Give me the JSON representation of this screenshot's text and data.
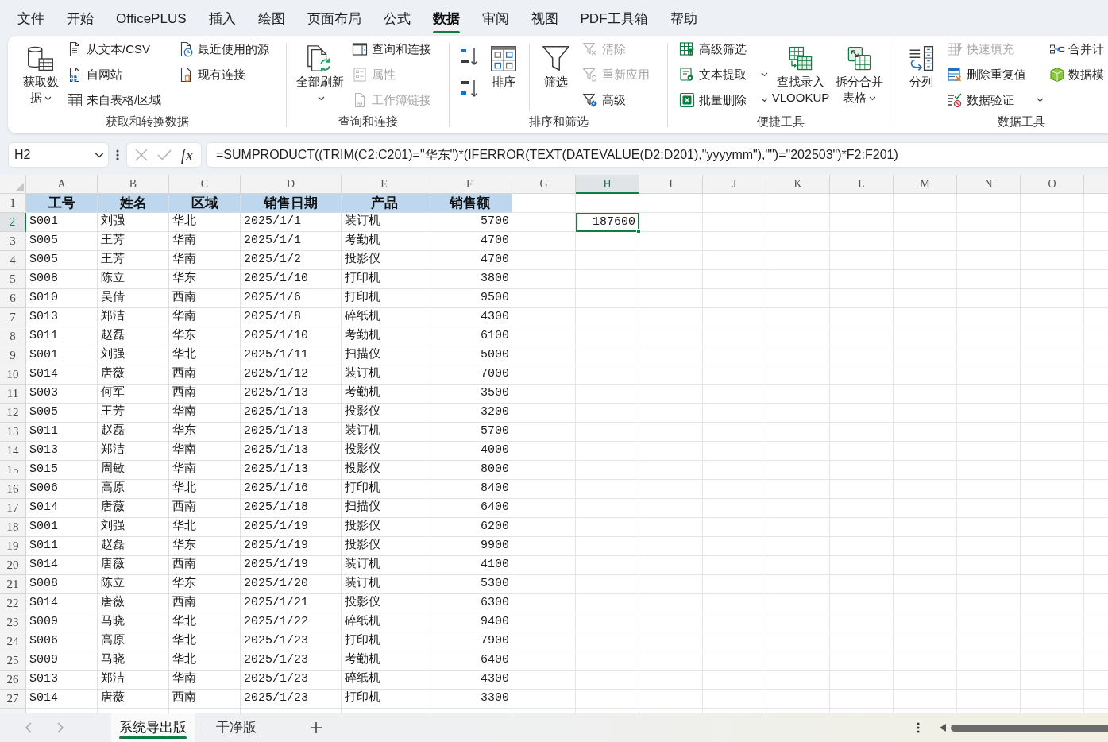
{
  "menu_tabs": [
    {
      "label": "文件",
      "selected": false
    },
    {
      "label": "开始",
      "selected": false
    },
    {
      "label": "OfficePLUS",
      "selected": false
    },
    {
      "label": "插入",
      "selected": false
    },
    {
      "label": "绘图",
      "selected": false
    },
    {
      "label": "页面布局",
      "selected": false
    },
    {
      "label": "公式",
      "selected": false
    },
    {
      "label": "数据",
      "selected": true
    },
    {
      "label": "审阅",
      "selected": false
    },
    {
      "label": "视图",
      "selected": false
    },
    {
      "label": "PDF工具箱",
      "selected": false
    },
    {
      "label": "帮助",
      "selected": false
    }
  ],
  "ribbon": {
    "groups": [
      {
        "label": "获取和转换数据",
        "columns": [
          {
            "kind": "large",
            "label": "获取数据",
            "disabled": false,
            "dropdown": true
          },
          {
            "kind": "stack",
            "items": [
              {
                "label": "从文本/CSV",
                "disabled": false,
                "dropdown": false
              },
              {
                "label": "自网站",
                "disabled": false,
                "dropdown": false
              },
              {
                "label": "来自表格/区域",
                "disabled": false,
                "dropdown": false
              }
            ]
          },
          {
            "kind": "stack",
            "items": [
              {
                "label": "最近使用的源",
                "disabled": false,
                "dropdown": false
              },
              {
                "label": "现有连接",
                "disabled": false,
                "dropdown": false
              }
            ]
          }
        ]
      },
      {
        "label": "查询和连接",
        "columns": [
          {
            "kind": "large",
            "label": "全部刷新",
            "disabled": false,
            "dropdown": true
          },
          {
            "kind": "stack",
            "items": [
              {
                "label": "查询和连接",
                "disabled": false,
                "dropdown": false
              },
              {
                "label": "属性",
                "disabled": true,
                "dropdown": false
              },
              {
                "label": "工作簿链接",
                "disabled": true,
                "dropdown": false
              }
            ]
          }
        ]
      },
      {
        "label": "排序和筛选",
        "columns": [
          {
            "kind": "sort_buttons"
          },
          {
            "kind": "large",
            "label": "排序",
            "disabled": false,
            "dropdown": false
          },
          {
            "kind": "divider"
          },
          {
            "kind": "large",
            "label": "筛选",
            "disabled": false,
            "dropdown": false
          },
          {
            "kind": "stack",
            "items": [
              {
                "label": "清除",
                "disabled": true,
                "dropdown": false
              },
              {
                "label": "重新应用",
                "disabled": true,
                "dropdown": false
              },
              {
                "label": "高级",
                "disabled": false,
                "dropdown": false
              }
            ]
          }
        ]
      },
      {
        "label": "便捷工具",
        "columns": [
          {
            "kind": "stack",
            "items": [
              {
                "label": "高级筛选",
                "disabled": false,
                "dropdown": false
              },
              {
                "label": "文本提取",
                "disabled": false,
                "dropdown": true
              },
              {
                "label": "批量删除",
                "disabled": false,
                "dropdown": true
              }
            ]
          },
          {
            "kind": "large",
            "label": "查找录入 VLOOKUP",
            "disabled": false,
            "dropdown": false
          },
          {
            "kind": "large",
            "label": "拆分合并表格",
            "disabled": false,
            "dropdown": true
          }
        ]
      },
      {
        "label": "数据工具",
        "columns": [
          {
            "kind": "large",
            "label": "分列",
            "disabled": false,
            "dropdown": false
          },
          {
            "kind": "stack",
            "items": [
              {
                "label": "快速填充",
                "disabled": true,
                "dropdown": false
              },
              {
                "label": "删除重复值",
                "disabled": false,
                "dropdown": false
              },
              {
                "label": "数据验证",
                "disabled": false,
                "dropdown": true
              }
            ]
          },
          {
            "kind": "stack",
            "items": [
              {
                "label": "合并计",
                "disabled": false
              },
              {
                "label": "数据模",
                "disabled": false
              }
            ]
          }
        ]
      }
    ]
  },
  "formula_bar": {
    "name_box": "H2",
    "function_button": "fx",
    "formula": "=SUMPRODUCT((TRIM(C2:C201)=\"华东\")*(IFERROR(TEXT(DATEVALUE(D2:D201),\"yyyymm\"),\"\")=\"202503\")*F2:F201)"
  },
  "sheet": {
    "columns": [
      {
        "label": "A",
        "selected": false
      },
      {
        "label": "B",
        "selected": false
      },
      {
        "label": "C",
        "selected": false
      },
      {
        "label": "D",
        "selected": false
      },
      {
        "label": "E",
        "selected": false
      },
      {
        "label": "F",
        "selected": false
      },
      {
        "label": "G",
        "selected": false
      },
      {
        "label": "H",
        "selected": true
      },
      {
        "label": "I",
        "selected": false
      },
      {
        "label": "J",
        "selected": false
      },
      {
        "label": "K",
        "selected": false
      },
      {
        "label": "L",
        "selected": false
      },
      {
        "label": "M",
        "selected": false
      },
      {
        "label": "N",
        "selected": false
      },
      {
        "label": "O",
        "selected": false
      }
    ],
    "rows": [
      {
        "number": "1",
        "selected": false,
        "kind": "header",
        "cells": [
          "工号",
          "姓名",
          "区域",
          "销售日期",
          "产品",
          "销售额"
        ]
      },
      {
        "number": "2",
        "selected": true,
        "kind": "data",
        "cells": [
          "S001",
          "刘强",
          "华北",
          "2025/1/1",
          "装订机",
          "5700"
        ]
      },
      {
        "number": "3",
        "selected": false,
        "kind": "data",
        "cells": [
          "S005",
          "王芳",
          "华南",
          "2025/1/1",
          "考勤机",
          "4700"
        ]
      },
      {
        "number": "4",
        "selected": false,
        "kind": "data",
        "cells": [
          "S005",
          "王芳",
          "华南",
          "2025/1/2",
          "投影仪",
          "4700"
        ]
      },
      {
        "number": "5",
        "selected": false,
        "kind": "data",
        "cells": [
          "S008",
          "陈立",
          "华东",
          "2025/1/10",
          "打印机",
          "3800"
        ]
      },
      {
        "number": "6",
        "selected": false,
        "kind": "data",
        "cells": [
          "S010",
          "吴倩",
          "西南",
          "2025/1/6",
          "打印机",
          "9500"
        ]
      },
      {
        "number": "7",
        "selected": false,
        "kind": "data",
        "cells": [
          "S013",
          "郑洁",
          "华南",
          "2025/1/8",
          "碎纸机",
          "4300"
        ]
      },
      {
        "number": "8",
        "selected": false,
        "kind": "data",
        "cells": [
          "S011",
          "赵磊",
          "华东",
          "2025/1/10",
          "考勤机",
          "6100"
        ]
      },
      {
        "number": "9",
        "selected": false,
        "kind": "data",
        "cells": [
          "S001",
          "刘强",
          "华北",
          "2025/1/11",
          "扫描仪",
          "5000"
        ]
      },
      {
        "number": "10",
        "selected": false,
        "kind": "data",
        "cells": [
          "S014",
          "唐薇",
          "西南",
          "2025/1/12",
          "装订机",
          "7000"
        ]
      },
      {
        "number": "11",
        "selected": false,
        "kind": "data",
        "cells": [
          "S003",
          "何军",
          "西南",
          "2025/1/13",
          "考勤机",
          "3500"
        ]
      },
      {
        "number": "12",
        "selected": false,
        "kind": "data",
        "cells": [
          "S005",
          "王芳",
          "华南",
          "2025/1/13",
          "投影仪",
          "3200"
        ]
      },
      {
        "number": "13",
        "selected": false,
        "kind": "data",
        "cells": [
          "S011",
          "赵磊",
          "华东",
          "2025/1/13",
          "装订机",
          "5700"
        ]
      },
      {
        "number": "14",
        "selected": false,
        "kind": "data",
        "cells": [
          "S013",
          "郑洁",
          "华南",
          "2025/1/13",
          "投影仪",
          "4000"
        ]
      },
      {
        "number": "15",
        "selected": false,
        "kind": "data",
        "cells": [
          "S015",
          "周敏",
          "华南",
          "2025/1/13",
          "投影仪",
          "8000"
        ]
      },
      {
        "number": "16",
        "selected": false,
        "kind": "data",
        "cells": [
          "S006",
          "高原",
          "华北",
          "2025/1/16",
          "打印机",
          "8400"
        ]
      },
      {
        "number": "17",
        "selected": false,
        "kind": "data",
        "cells": [
          "S014",
          "唐薇",
          "西南",
          "2025/1/18",
          "扫描仪",
          "6400"
        ]
      },
      {
        "number": "18",
        "selected": false,
        "kind": "data",
        "cells": [
          "S001",
          "刘强",
          "华北",
          "2025/1/19",
          "投影仪",
          "6200"
        ]
      },
      {
        "number": "19",
        "selected": false,
        "kind": "data",
        "cells": [
          "S011",
          "赵磊",
          "华东",
          "2025/1/19",
          "投影仪",
          "9900"
        ]
      },
      {
        "number": "20",
        "selected": false,
        "kind": "data",
        "cells": [
          "S014",
          "唐薇",
          "西南",
          "2025/1/19",
          "装订机",
          "4100"
        ]
      },
      {
        "number": "21",
        "selected": false,
        "kind": "data",
        "cells": [
          "S008",
          "陈立",
          "华东",
          "2025/1/20",
          "装订机",
          "5300"
        ]
      },
      {
        "number": "22",
        "selected": false,
        "kind": "data",
        "cells": [
          "S014",
          "唐薇",
          "西南",
          "2025/1/21",
          "投影仪",
          "6300"
        ]
      },
      {
        "number": "23",
        "selected": false,
        "kind": "data",
        "cells": [
          "S009",
          "马晓",
          "华北",
          "2025/1/22",
          "碎纸机",
          "9400"
        ]
      },
      {
        "number": "24",
        "selected": false,
        "kind": "data",
        "cells": [
          "S006",
          "高原",
          "华北",
          "2025/1/23",
          "打印机",
          "7900"
        ]
      },
      {
        "number": "25",
        "selected": false,
        "kind": "data",
        "cells": [
          "S009",
          "马晓",
          "华北",
          "2025/1/23",
          "考勤机",
          "6400"
        ]
      },
      {
        "number": "26",
        "selected": false,
        "kind": "data",
        "cells": [
          "S013",
          "郑洁",
          "华南",
          "2025/1/23",
          "碎纸机",
          "4300"
        ]
      },
      {
        "number": "27",
        "selected": false,
        "kind": "data",
        "cells": [
          "S014",
          "唐薇",
          "西南",
          "2025/1/23",
          "打印机",
          "3300"
        ]
      }
    ],
    "active_cell": {
      "value": "187600"
    }
  },
  "sheet_tabs": [
    {
      "label": "系统导出版",
      "selected": true
    },
    {
      "label": "干净版",
      "selected": false
    }
  ]
}
